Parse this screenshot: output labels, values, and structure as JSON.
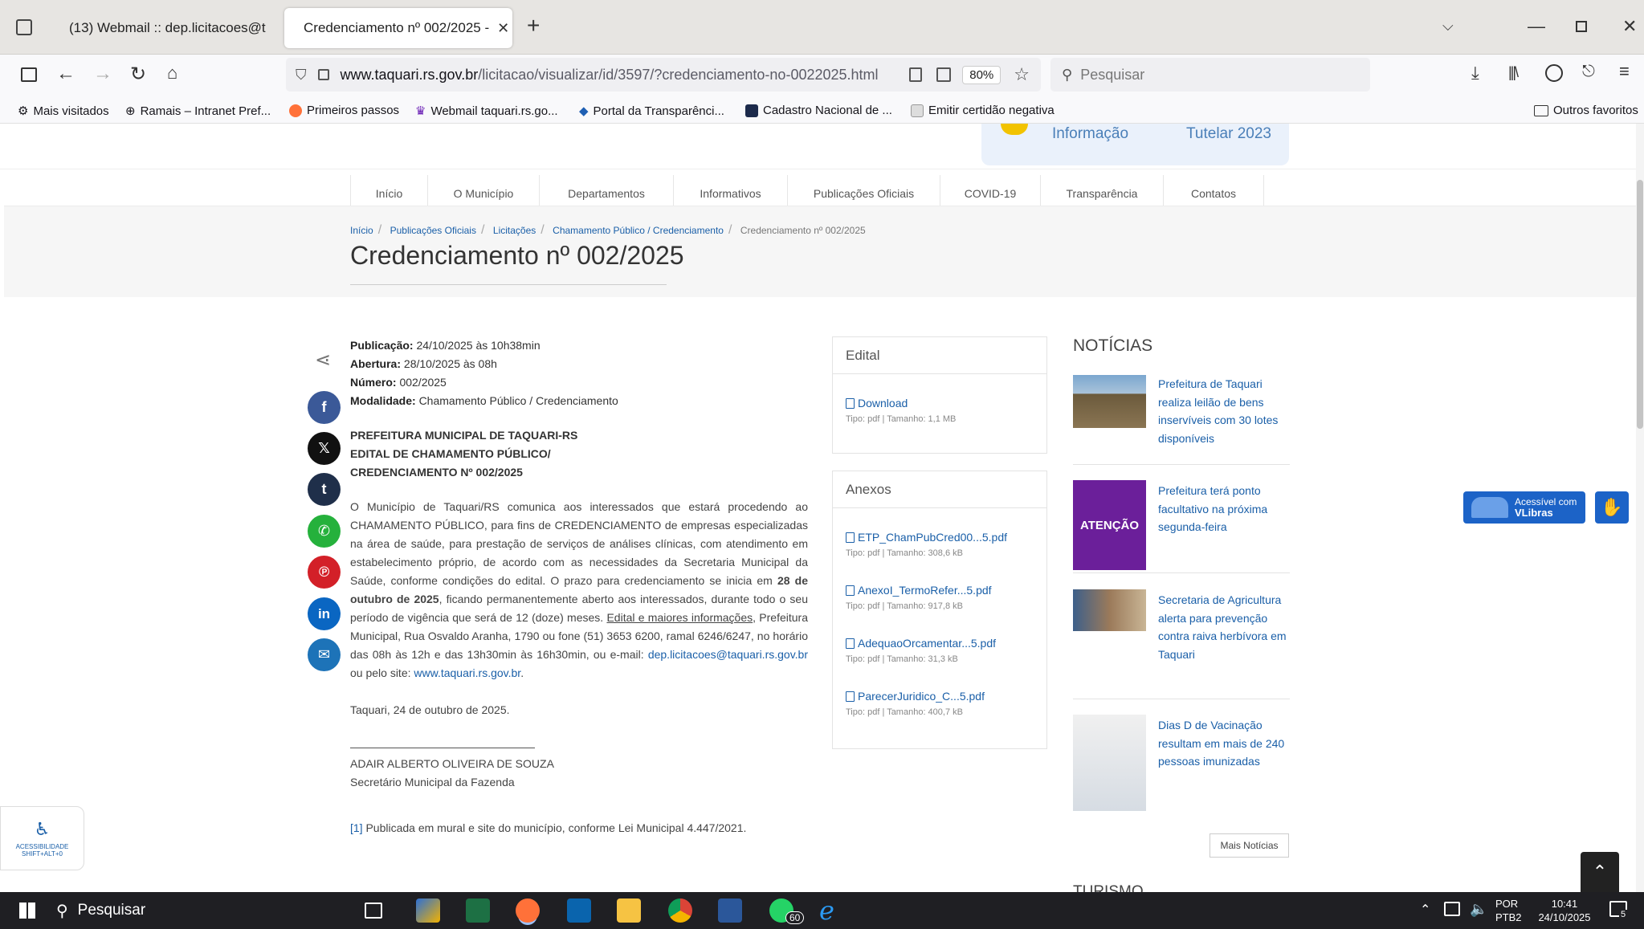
{
  "browser": {
    "tabs": [
      {
        "label": "(13) Webmail :: dep.licitacoes@t",
        "active": false
      },
      {
        "label": "Credenciamento nº 002/2025 - ",
        "active": true
      }
    ],
    "new_tab": "+",
    "url_domain": "www.taquari.rs.gov.br",
    "url_path": "/licitacao/visualizar/id/3597/?credenciamento-no-0022025.html",
    "zoom": "80%",
    "search_placeholder": "Pesquisar",
    "bookmarks": [
      "Mais visitados",
      "Ramais – Intranet Pref...",
      "Primeiros passos",
      "Webmail taquari.rs.go...",
      "Portal da Transparênci...",
      "Cadastro Nacional de ...",
      "Emitir certidão negativa"
    ],
    "other_bookmarks": "Outros favoritos"
  },
  "banner": {
    "item1": "Informação",
    "item2": "Tutelar 2023"
  },
  "menu": [
    "Início",
    "O Município",
    "Departamentos",
    "Informativos",
    "Publicações Oficiais",
    "COVID-19",
    "Transparência",
    "Contatos"
  ],
  "breadcrumb": [
    "Início",
    "Publicações Oficiais",
    "Licitações",
    "Chamamento Público / Credenciamento",
    "Credenciamento nº 002/2025"
  ],
  "page_title": "Credenciamento nº 002/2025",
  "meta": {
    "pub_label": "Publicação:",
    "pub_value": "24/10/2025 às 10h38min",
    "abe_label": "Abertura:",
    "abe_value": "28/10/2025 às 08h",
    "num_label": "Número:",
    "num_value": "002/2025",
    "mod_label": "Modalidade:",
    "mod_value": "Chamamento Público / Credenciamento"
  },
  "heading_lines": [
    "PREFEITURA MUNICIPAL DE TAQUARI-RS",
    "EDITAL DE CHAMAMENTO PÚBLICO/",
    "CREDENCIAMENTO Nº 002/2025"
  ],
  "body": {
    "p1": "O Município de Taquari/RS comunica aos interessados que estará procedendo ao CHAMAMENTO PÚBLICO, para fins de CREDENCIAMENTO de empresas especializadas na área de saúde, para prestação de serviços de análises clínicas, com atendimento em estabelecimento próprio, de acordo com as necessidades da Secretaria Municipal da Saúde, conforme condições do edital. O prazo para credenciamento se inicia em",
    "p1_bold": "28 de outubro de 2025",
    "p1b": ", ficando permanentemente aberto aos interessados, durante todo o seu período de vigência que será de 12 (doze) meses.",
    "link_edital": "Edital e maiores informações",
    "p1c": ", Prefeitura Municipal, Rua Osvaldo Aranha, 1790 ou fone (51) 3653 6200, ramal 6246/6247, no horário das 08h às 12h e das 13h30min às 16h30min, ou e-mail:",
    "email": "dep.licitacoes@taquari.rs.gov.br",
    "p1d": "ou pelo site:",
    "site": "www.taquari.rs.gov.br",
    "p1e": ".",
    "date_line": "Taquari, 24 de outubro de 2025.",
    "sig_name": "ADAIR ALBERTO OLIVEIRA DE SOUZA",
    "sig_role": "Secretário Municipal da Fazenda",
    "footnote_ref": "[1]",
    "footnote": " Publicada em mural e site do município, conforme Lei Municipal 4.447/2021."
  },
  "edital": {
    "title": "Edital",
    "files": [
      {
        "name": "Download",
        "type": "Tipo: pdf",
        "size": "Tamanho: 1,1 MB"
      }
    ]
  },
  "anexos": {
    "title": "Anexos",
    "files": [
      {
        "name": "ETP_ChamPubCred00...5.pdf",
        "type": "Tipo: pdf",
        "size": "Tamanho: 308,6 kB"
      },
      {
        "name": "AnexoI_TermoRefer...5.pdf",
        "type": "Tipo: pdf",
        "size": "Tamanho: 917,8 kB"
      },
      {
        "name": "AdequaoOrcamentar...5.pdf",
        "type": "Tipo: pdf",
        "size": "Tamanho: 31,3 kB"
      },
      {
        "name": "ParecerJuridico_C...5.pdf",
        "type": "Tipo: pdf",
        "size": "Tamanho: 400,7 kB"
      }
    ]
  },
  "news": {
    "title": "NOTÍCIAS",
    "items": [
      "Prefeitura de Taquari realiza leilão de bens inservíveis com 30 lotes disponíveis",
      "Prefeitura terá ponto facultativo na próxima segunda-feira",
      "Secretaria de Agricultura alerta para prevenção contra raiva herbívora em Taquari",
      "Dias D de Vacinação resultam em mais de 240 pessoas imunizadas"
    ],
    "thumb2_text": "ATENÇÃO",
    "more": "Mais Notícias",
    "next_section": "TURISMO"
  },
  "vlibras": {
    "line1": "Acessível com",
    "line2": "VLibras"
  },
  "accessibility": {
    "line1": "ACESSIBILIDADE",
    "line2": "SHIFT+ALT+0"
  },
  "taskbar": {
    "search": "Pesquisar",
    "whatsapp_badge": "60",
    "lang1": "POR",
    "lang2": "PTB2",
    "time": "10:41",
    "date": "24/10/2025",
    "notif": "5"
  }
}
